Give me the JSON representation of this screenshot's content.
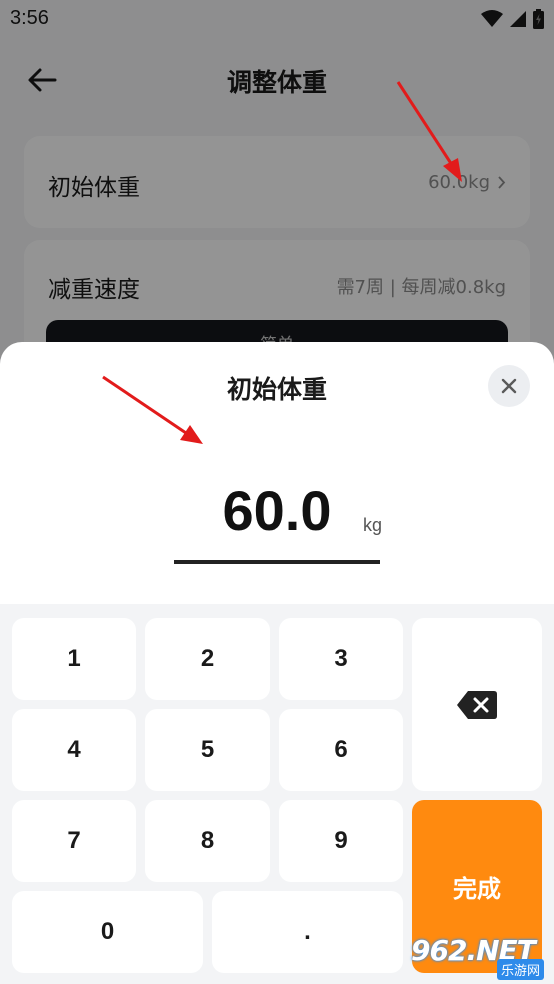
{
  "status_bar": {
    "time": "3:56"
  },
  "header": {
    "title": "调整体重"
  },
  "settings": {
    "initial_weight": {
      "label": "初始体重",
      "value": "60.0kg"
    },
    "loss_speed": {
      "label": "减重速度",
      "value": "需7周 | 每周减0.8kg",
      "mode": "简单"
    }
  },
  "sheet": {
    "title": "初始体重",
    "value": "60.0",
    "unit": "kg"
  },
  "keypad": {
    "keys": [
      "1",
      "2",
      "3",
      "4",
      "5",
      "6",
      "7",
      "8",
      "9",
      "0",
      "."
    ],
    "done_label": "完成"
  },
  "watermark": {
    "main": "962.NET",
    "sub": "乐游网"
  },
  "colors": {
    "accent": "#ff8a0f",
    "annotation_arrow": "#e21b1b"
  },
  "icons": {
    "back": "arrow-left-icon",
    "chevron": "chevron-right-icon",
    "close": "close-icon",
    "backspace": "backspace-icon"
  }
}
